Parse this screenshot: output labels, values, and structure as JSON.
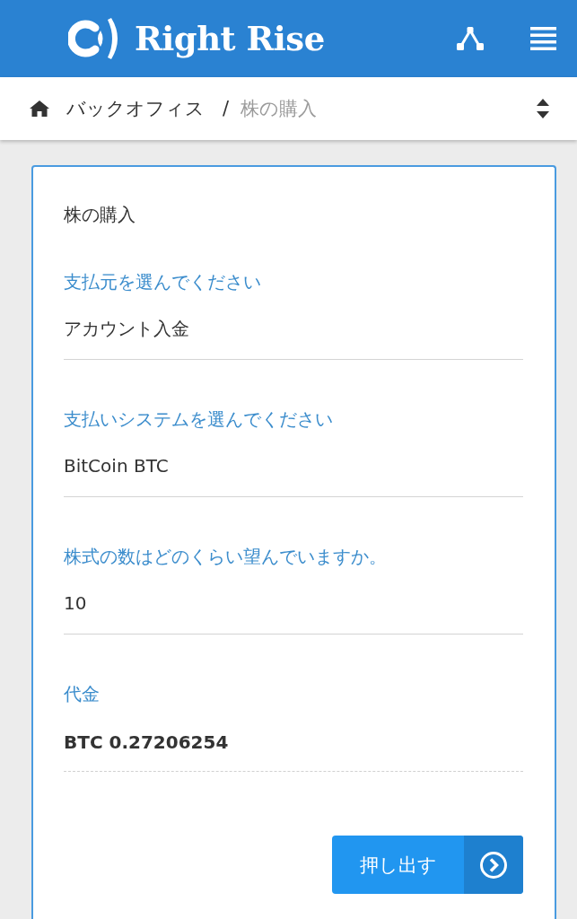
{
  "header": {
    "brand": "Right Rise"
  },
  "breadcrumb": {
    "items": [
      {
        "label": "バックオフィス",
        "current": false
      },
      {
        "label": "株の購入",
        "current": true
      }
    ],
    "separator": "/"
  },
  "form": {
    "title": "株の購入",
    "fields": [
      {
        "kind": "select",
        "label": "支払元を選んでください",
        "value": "アカウント入金"
      },
      {
        "kind": "select",
        "label": "支払いシステムを選んでください",
        "value": "BitCoin BTC"
      },
      {
        "kind": "input",
        "label": "株式の数はどのくらい望んでいますか。",
        "value": "10"
      },
      {
        "kind": "readonly",
        "label": "代金",
        "value": "BTC 0.27206254"
      }
    ],
    "submit": {
      "label": "押し出す"
    }
  }
}
